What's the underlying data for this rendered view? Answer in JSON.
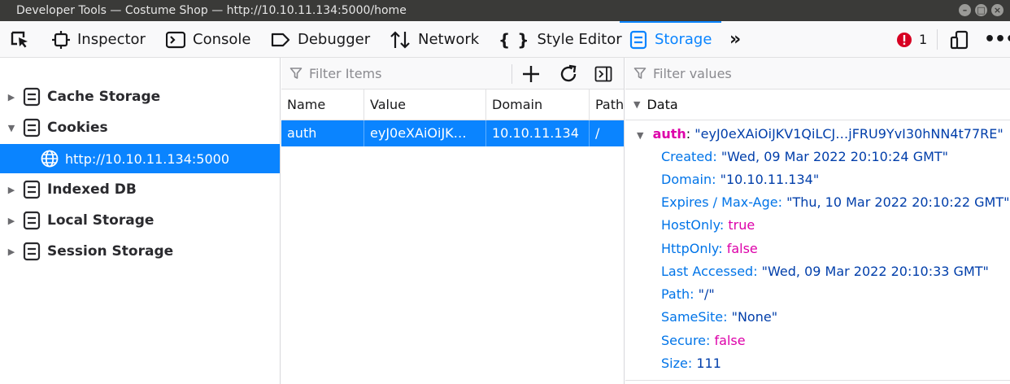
{
  "window": {
    "title": "Developer Tools — Costume Shop — http://10.10.11.134:5000/home",
    "minimize": "–",
    "maximize": "□",
    "close": "×"
  },
  "toolbar": {
    "tools": [
      {
        "label": "Inspector",
        "icon": "inspector-icon"
      },
      {
        "label": "Console",
        "icon": "console-icon"
      },
      {
        "label": "Debugger",
        "icon": "debugger-icon"
      },
      {
        "label": "Network",
        "icon": "network-icon"
      },
      {
        "label": "Style Editor",
        "icon": "style-editor-icon"
      },
      {
        "label": "Storage",
        "icon": "storage-icon",
        "selected": true
      }
    ],
    "error_count": "1"
  },
  "sidebar": {
    "items": [
      {
        "label": "Cache Storage",
        "expanded": false
      },
      {
        "label": "Cookies",
        "expanded": true
      },
      {
        "label": "Indexed DB",
        "expanded": false
      },
      {
        "label": "Local Storage",
        "expanded": false
      },
      {
        "label": "Session Storage",
        "expanded": false
      }
    ],
    "cookie_host": "http://10.10.11.134:5000"
  },
  "table": {
    "filter_placeholder": "Filter Items",
    "columns": [
      "Name",
      "Value",
      "Domain",
      "Path"
    ],
    "rows": [
      {
        "name": "auth",
        "value": "eyJ0eXAiOiJK…",
        "domain": "10.10.11.134",
        "path": "/"
      }
    ]
  },
  "details": {
    "filter_placeholder": "Filter values",
    "section_label": "Data",
    "root_key": "auth",
    "root_value": "\"eyJ0eXAiOiJKV1QiLCJ…jFRU9YvI30hNN4t77RE\"",
    "props": [
      {
        "key": "Created",
        "value": "\"Wed, 09 Mar 2022 20:10:24 GMT\"",
        "type": "string"
      },
      {
        "key": "Domain",
        "value": "\"10.10.11.134\"",
        "type": "string"
      },
      {
        "key": "Expires / Max-Age",
        "value": "\"Thu, 10 Mar 2022 20:10:22 GMT\"",
        "type": "string"
      },
      {
        "key": "HostOnly",
        "value": "true",
        "type": "bool"
      },
      {
        "key": "HttpOnly",
        "value": "false",
        "type": "bool"
      },
      {
        "key": "Last Accessed",
        "value": "\"Wed, 09 Mar 2022 20:10:33 GMT\"",
        "type": "string"
      },
      {
        "key": "Path",
        "value": "\"/\"",
        "type": "string"
      },
      {
        "key": "SameSite",
        "value": "\"None\"",
        "type": "string"
      },
      {
        "key": "Secure",
        "value": "false",
        "type": "bool"
      },
      {
        "key": "Size",
        "value": "111",
        "type": "number"
      }
    ]
  },
  "colors": {
    "accent": "#0a84ff",
    "key_blue": "#0074e8",
    "string_blue": "#003eaa",
    "bool_magenta": "#dd00a9"
  }
}
